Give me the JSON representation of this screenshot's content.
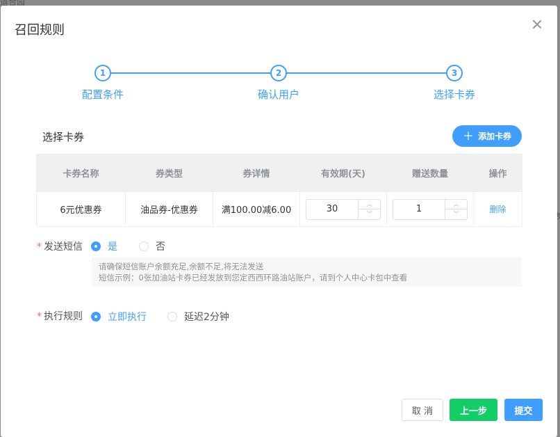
{
  "backdrop": {
    "top_text": "道合园",
    "right_text": "表"
  },
  "dialog": {
    "title": "召回规则",
    "close_icon": "close-icon"
  },
  "steps": [
    {
      "number": "1",
      "label": "配置条件"
    },
    {
      "number": "2",
      "label": "确认用户"
    },
    {
      "number": "3",
      "label": "选择卡券"
    }
  ],
  "coupon_section": {
    "title": "选择卡券",
    "add_button": "添加卡券"
  },
  "table": {
    "headers": [
      "卡券名称",
      "券类型",
      "券详情",
      "有效期(天)",
      "赠送数量",
      "操作"
    ],
    "rows": [
      {
        "name": "6元优惠券",
        "type": "油品券-优惠券",
        "detail": "满100.00减6.00",
        "validity": "30",
        "quantity": "1",
        "action": "删除"
      }
    ]
  },
  "sms": {
    "label": "发送短信",
    "options": [
      "是",
      "否"
    ],
    "selected": "是",
    "notice_line1": "请确保短信账户余额充足,余额不足,将无法发送",
    "notice_line2": "短信示例：0张加油站卡券已经发放到您定西西环路油站账户，请到个人中心卡包中查看"
  },
  "execution": {
    "label": "执行规则",
    "options": [
      "立即执行",
      "延迟2分钟"
    ],
    "selected": "立即执行"
  },
  "footer": {
    "cancel": "取 消",
    "prev": "上一步",
    "submit": "提交"
  },
  "colors": {
    "primary": "#409eff",
    "success": "#13ce66",
    "required": "#f56c6c"
  }
}
